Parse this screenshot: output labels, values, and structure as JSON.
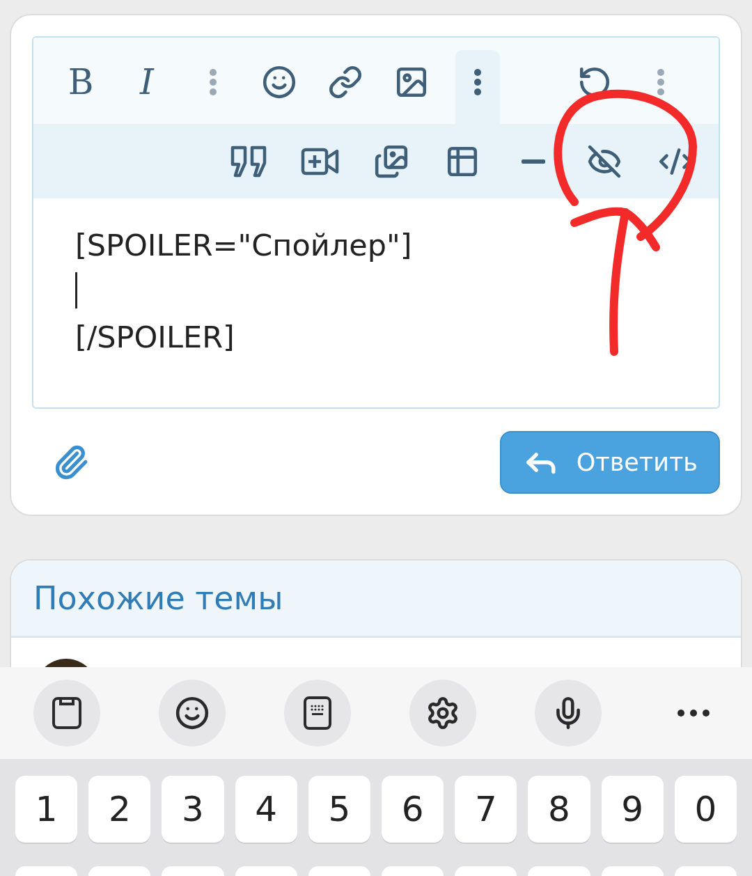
{
  "editor": {
    "toolbar_row_1": [
      {
        "kind": "bold",
        "label": "B",
        "active": false
      },
      {
        "kind": "italic",
        "label": "I",
        "active": false
      },
      {
        "kind": "more-faint",
        "active": false
      },
      {
        "kind": "emoji",
        "active": false
      },
      {
        "kind": "link",
        "active": false
      },
      {
        "kind": "image",
        "active": false
      },
      {
        "kind": "more",
        "active": true
      },
      {
        "kind": "spacer"
      },
      {
        "kind": "undo",
        "active": false
      },
      {
        "kind": "more-faint",
        "active": false
      }
    ],
    "toolbar_row_2": [
      {
        "kind": "quote"
      },
      {
        "kind": "video"
      },
      {
        "kind": "gallery"
      },
      {
        "kind": "table"
      },
      {
        "kind": "rule"
      },
      {
        "kind": "spoiler"
      },
      {
        "kind": "code"
      }
    ],
    "content_lines": [
      "[SPOILER=\"Спойлер\"]",
      "[/SPOILER]"
    ]
  },
  "reply_button": {
    "label": "Ответить"
  },
  "similar_topics": {
    "title": "Похожие темы"
  },
  "keyboard": {
    "toolbar": [
      {
        "kind": "clipboard"
      },
      {
        "kind": "emoji"
      },
      {
        "kind": "keypad"
      },
      {
        "kind": "settings"
      },
      {
        "kind": "mic"
      },
      {
        "kind": "more"
      }
    ],
    "number_keys": [
      "1",
      "2",
      "3",
      "4",
      "5",
      "6",
      "7",
      "8",
      "9",
      "0"
    ]
  }
}
